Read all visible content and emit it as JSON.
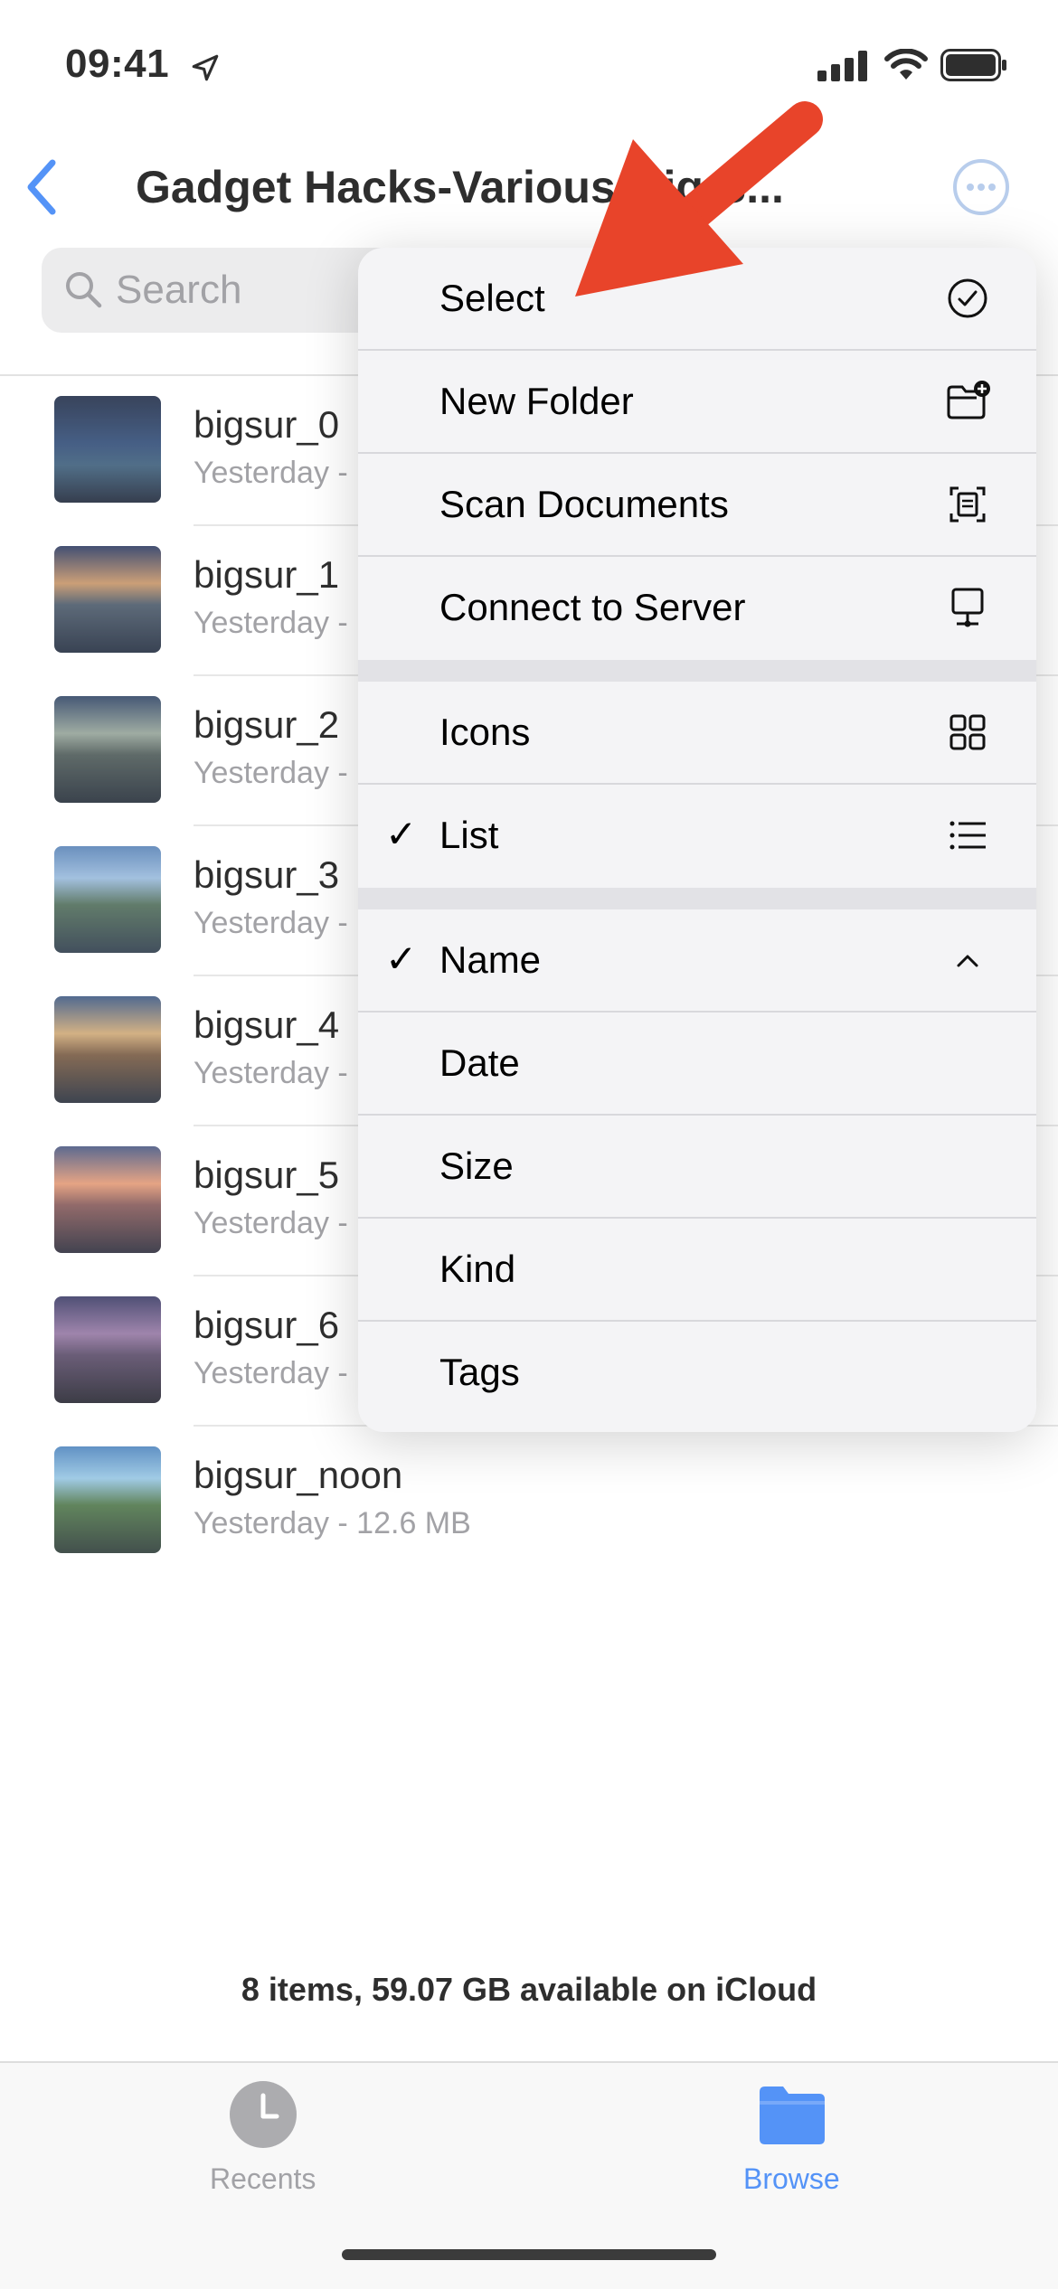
{
  "status_bar": {
    "time": "09:41"
  },
  "header": {
    "title": "Gadget Hacks-Various-Big S..."
  },
  "search": {
    "placeholder": "Search"
  },
  "files": [
    {
      "name": "bigsur_0",
      "meta": "Yesterday -"
    },
    {
      "name": "bigsur_1",
      "meta": "Yesterday -"
    },
    {
      "name": "bigsur_2",
      "meta": "Yesterday -"
    },
    {
      "name": "bigsur_3",
      "meta": "Yesterday -"
    },
    {
      "name": "bigsur_4",
      "meta": "Yesterday -"
    },
    {
      "name": "bigsur_5",
      "meta": "Yesterday -"
    },
    {
      "name": "bigsur_6",
      "meta": "Yesterday -"
    },
    {
      "name": "bigsur_noon",
      "meta": "Yesterday - 12.6 MB"
    }
  ],
  "menu": {
    "select": "Select",
    "new_folder": "New Folder",
    "scan_documents": "Scan Documents",
    "connect_to_server": "Connect to Server",
    "icons": "Icons",
    "list": "List",
    "name": "Name",
    "date": "Date",
    "size": "Size",
    "kind": "Kind",
    "tags": "Tags",
    "check_mark": "✓"
  },
  "footer": {
    "summary": "8 items, 59.07 GB available on iCloud"
  },
  "tabs": {
    "recents": "Recents",
    "browse": "Browse"
  },
  "colors": {
    "accent": "#2f7cf6",
    "arrow": "#e8442a",
    "muted": "#8e8e93"
  }
}
